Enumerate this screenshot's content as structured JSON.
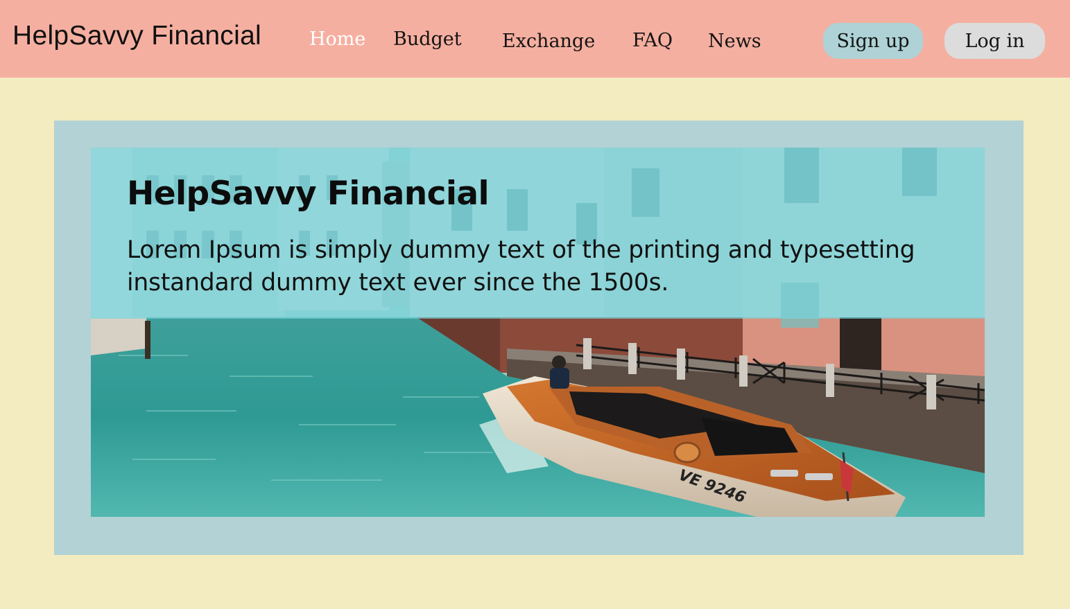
{
  "header": {
    "brand": "HelpSavvy Financial",
    "nav": [
      {
        "label": "Home",
        "active": true
      },
      {
        "label": "Budget",
        "active": false
      },
      {
        "label": "Exchange",
        "active": false
      },
      {
        "label": "FAQ",
        "active": false
      },
      {
        "label": "News",
        "active": false
      }
    ],
    "signup_label": "Sign up",
    "login_label": "Log in"
  },
  "hero": {
    "title": "HelpSavvy Financial",
    "text": "Lorem Ipsum is simply dummy text of the printing and typesetting instandard dummy text ever since the 1500s.",
    "boat_registration": "VE 9246"
  },
  "colors": {
    "header_bg": "#f5afa0",
    "page_bg": "#f3ecc0",
    "frame_bg": "#b2d2d5",
    "active_nav": "#ffffff",
    "signup_bg": "#aed2d5",
    "login_bg": "#dcdcdc",
    "overlay": "#76d6de"
  }
}
